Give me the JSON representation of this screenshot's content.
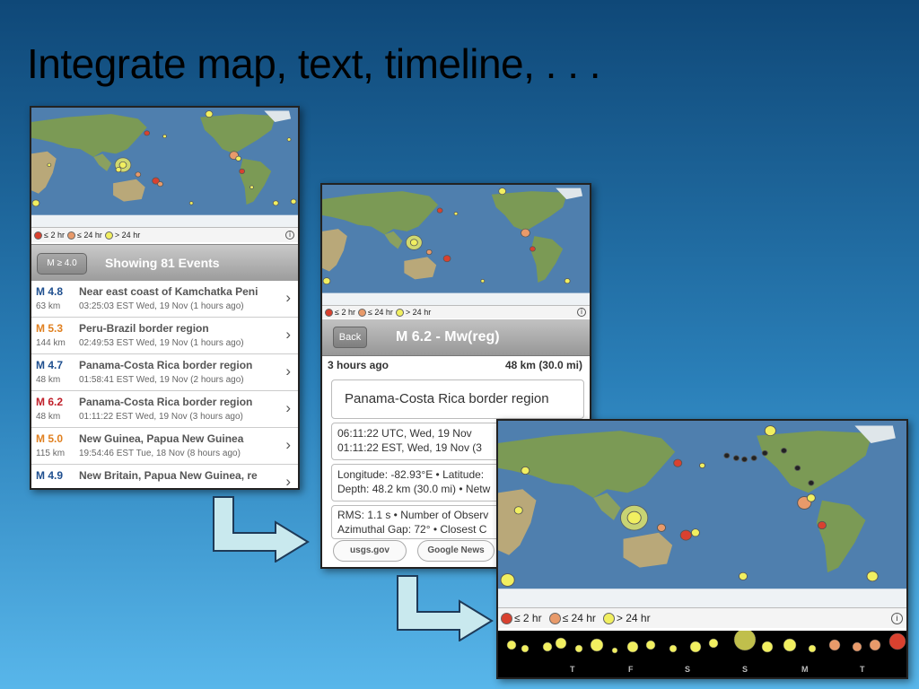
{
  "slide": {
    "title": "Integrate map, text, timeline, . . ."
  },
  "legend": {
    "items": [
      {
        "label": "≤ 2 hr",
        "color": "#d9412f"
      },
      {
        "label": "≤ 24 hr",
        "color": "#e89a6a"
      },
      {
        "label": "> 24 hr",
        "color": "#f1ef60"
      }
    ],
    "info_icon": "i"
  },
  "list_screen": {
    "filter_button": "M ≥ 4.0",
    "title": "Showing 81 Events",
    "events": [
      {
        "mag": "M 4.8",
        "color": "#1f4f8f",
        "region": "Near east coast of Kamchatka Peni",
        "depth": "63 km",
        "time": "03:25:03 EST Wed, 19 Nov (1 hours ago)"
      },
      {
        "mag": "M 5.3",
        "color": "#e08020",
        "region": "Peru-Brazil border region",
        "depth": "144 km",
        "time": "02:49:53 EST Wed, 19 Nov (1 hours ago)"
      },
      {
        "mag": "M 4.7",
        "color": "#1f4f8f",
        "region": "Panama-Costa Rica border region",
        "depth": "48 km",
        "time": "01:58:41 EST Wed, 19 Nov (2 hours ago)"
      },
      {
        "mag": "M 6.2",
        "color": "#c0202a",
        "region": "Panama-Costa Rica border region",
        "depth": "48 km",
        "time": "01:11:22 EST Wed, 19 Nov (3 hours ago)"
      },
      {
        "mag": "M 5.0",
        "color": "#e08020",
        "region": "New Guinea, Papua New Guinea",
        "depth": "115 km",
        "time": "19:54:46 EST Tue, 18 Nov (8 hours ago)"
      },
      {
        "mag": "M 4.9",
        "color": "#1f4f8f",
        "region": "New Britain, Papua New Guinea, re",
        "depth": "",
        "time": ""
      }
    ],
    "chevron": "›"
  },
  "detail_screen": {
    "back_label": "Back",
    "title": "M 6.2 - Mw(reg)",
    "ago": "3 hours ago",
    "depth_summary": "48 km (30.0 mi)",
    "region": "Panama-Costa Rica border region",
    "utc_time": "06:11:22 UTC, Wed, 19 Nov",
    "est_time": "01:11:22 EST, Wed, 19 Nov (3",
    "coords": "Longitude: -82.93°E • Latitude:",
    "depth_line": "Depth: 48.2 km (30.0 mi) • Netw",
    "rms": "RMS: 1.1 s • Number of Observ",
    "gap": "Azimuthal Gap: 72° • Closest C",
    "links": [
      "usgs.gov",
      "Google News"
    ]
  },
  "timeline": {
    "days": [
      "T",
      "F",
      "S",
      "S",
      "M",
      "T"
    ]
  },
  "colors": {
    "ocean": "#4f7fae",
    "land": "#7b9a55",
    "desert": "#b9a879",
    "ice": "#eef2f5"
  }
}
